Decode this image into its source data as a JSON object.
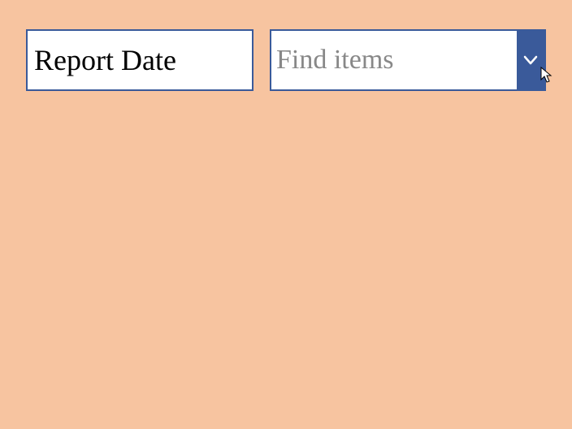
{
  "filter": {
    "label": "Report Date",
    "placeholder": "Find items"
  },
  "colors": {
    "background": "#f7c4a0",
    "border": "#3a5a9a",
    "toggle_bg": "#3a5a9a",
    "placeholder": "#888888"
  }
}
